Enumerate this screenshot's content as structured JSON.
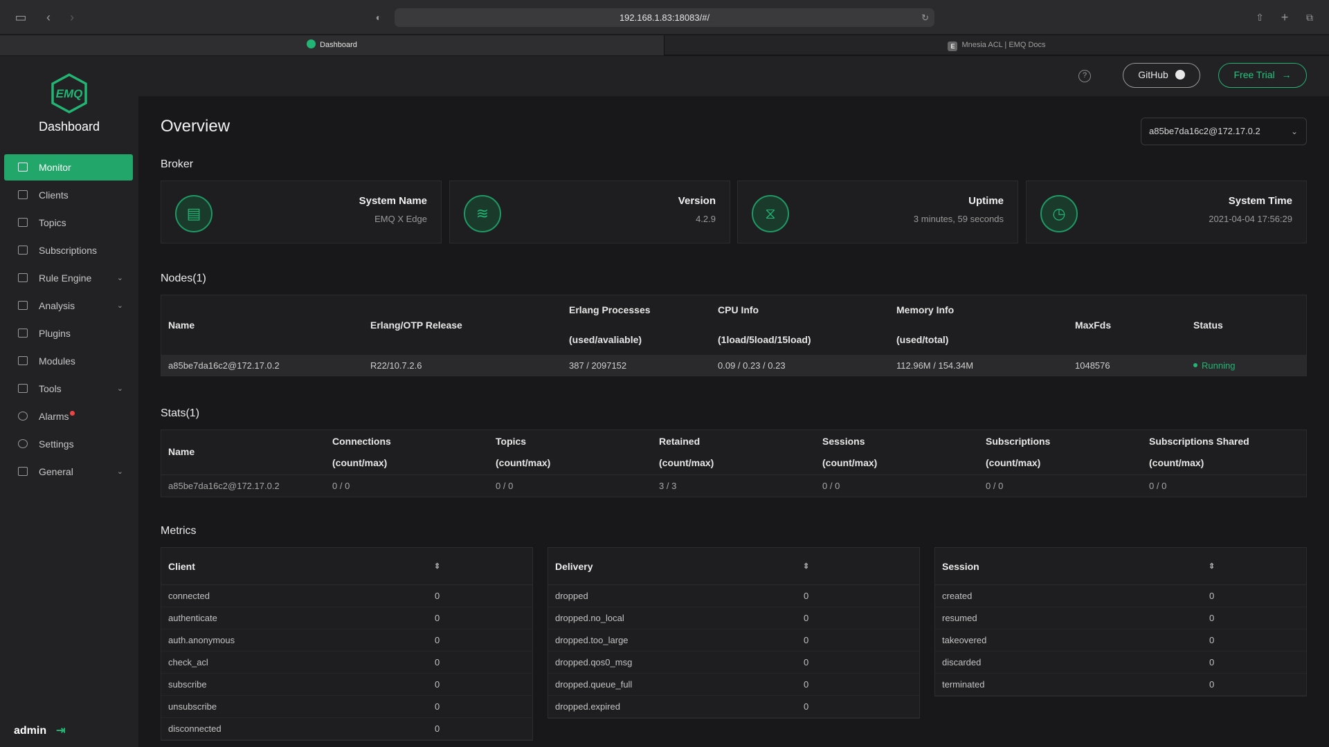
{
  "browser": {
    "url": "192.168.1.83:18083/#/",
    "tabs": [
      {
        "label": "Dashboard",
        "active": true
      },
      {
        "label": "Mnesia ACL | EMQ Docs",
        "active": false
      }
    ]
  },
  "sidebar": {
    "logo_text": "EMQ",
    "title": "Dashboard",
    "items": [
      {
        "label": "Monitor",
        "icon": "monitor-icon",
        "active": true,
        "expandable": false
      },
      {
        "label": "Clients",
        "icon": "clients-icon",
        "expandable": false
      },
      {
        "label": "Topics",
        "icon": "topics-icon",
        "expandable": false
      },
      {
        "label": "Subscriptions",
        "icon": "subscriptions-icon",
        "expandable": false
      },
      {
        "label": "Rule Engine",
        "icon": "rule-engine-icon",
        "expandable": true
      },
      {
        "label": "Analysis",
        "icon": "analysis-icon",
        "expandable": true
      },
      {
        "label": "Plugins",
        "icon": "plugins-icon",
        "expandable": false
      },
      {
        "label": "Modules",
        "icon": "modules-icon",
        "expandable": false
      },
      {
        "label": "Tools",
        "icon": "tools-icon",
        "expandable": true
      },
      {
        "label": "Alarms",
        "icon": "alarms-icon",
        "expandable": false,
        "badge": true
      },
      {
        "label": "Settings",
        "icon": "settings-icon",
        "expandable": false
      },
      {
        "label": "General",
        "icon": "general-icon",
        "expandable": true
      }
    ],
    "user": "admin"
  },
  "header": {
    "help": "?",
    "github_label": "GitHub",
    "trial_label": "Free Trial"
  },
  "main": {
    "title": "Overview",
    "node_selector": "a85be7da16c2@172.17.0.2",
    "broker": {
      "section_title": "Broker",
      "cards": [
        {
          "label": "System Name",
          "value": "EMQ X Edge",
          "icon": "document-icon"
        },
        {
          "label": "Version",
          "value": "4.2.9",
          "icon": "layers-icon"
        },
        {
          "label": "Uptime",
          "value": "3 minutes, 59 seconds",
          "icon": "hourglass-icon"
        },
        {
          "label": "System Time",
          "value": "2021-04-04 17:56:29",
          "icon": "clock-icon"
        }
      ]
    },
    "nodes": {
      "section_title": "Nodes(1)",
      "headers": [
        "Name",
        "Erlang/OTP Release",
        "Erlang Processes",
        "(used/avaliable)",
        "CPU Info",
        "(1load/5load/15load)",
        "Memory Info",
        "(used/total)",
        "MaxFds",
        "Status"
      ],
      "row": {
        "name": "a85be7da16c2@172.17.0.2",
        "otp": "R22/10.7.2.6",
        "processes": "387 / 2097152",
        "cpu": "0.09 / 0.23 / 0.23",
        "memory": "112.96M / 154.34M",
        "maxfds": "1048576",
        "status": "Running"
      }
    },
    "stats": {
      "section_title": "Stats(1)",
      "headers": [
        {
          "title": "Name",
          "sub": ""
        },
        {
          "title": "Connections",
          "sub": "(count/max)"
        },
        {
          "title": "Topics",
          "sub": "(count/max)"
        },
        {
          "title": "Retained",
          "sub": "(count/max)"
        },
        {
          "title": "Sessions",
          "sub": "(count/max)"
        },
        {
          "title": "Subscriptions",
          "sub": "(count/max)"
        },
        {
          "title": "Subscriptions Shared",
          "sub": "(count/max)"
        }
      ],
      "row": [
        "a85be7da16c2@172.17.0.2",
        "0 / 0",
        "0 / 0",
        "3 / 3",
        "0 / 0",
        "0 / 0",
        "0 / 0"
      ]
    },
    "metrics": {
      "section_title": "Metrics",
      "client": {
        "title": "Client",
        "rows": [
          {
            "k": "connected",
            "v": "0"
          },
          {
            "k": "authenticate",
            "v": "0"
          },
          {
            "k": "auth.anonymous",
            "v": "0"
          },
          {
            "k": "check_acl",
            "v": "0"
          },
          {
            "k": "subscribe",
            "v": "0"
          },
          {
            "k": "unsubscribe",
            "v": "0"
          },
          {
            "k": "disconnected",
            "v": "0"
          }
        ]
      },
      "delivery": {
        "title": "Delivery",
        "rows": [
          {
            "k": "dropped",
            "v": "0"
          },
          {
            "k": "dropped.no_local",
            "v": "0"
          },
          {
            "k": "dropped.too_large",
            "v": "0"
          },
          {
            "k": "dropped.qos0_msg",
            "v": "0"
          },
          {
            "k": "dropped.queue_full",
            "v": "0"
          },
          {
            "k": "dropped.expired",
            "v": "0"
          }
        ]
      },
      "session": {
        "title": "Session",
        "rows": [
          {
            "k": "created",
            "v": "0"
          },
          {
            "k": "resumed",
            "v": "0"
          },
          {
            "k": "takeovered",
            "v": "0"
          },
          {
            "k": "discarded",
            "v": "0"
          },
          {
            "k": "terminated",
            "v": "0"
          }
        ]
      }
    }
  }
}
